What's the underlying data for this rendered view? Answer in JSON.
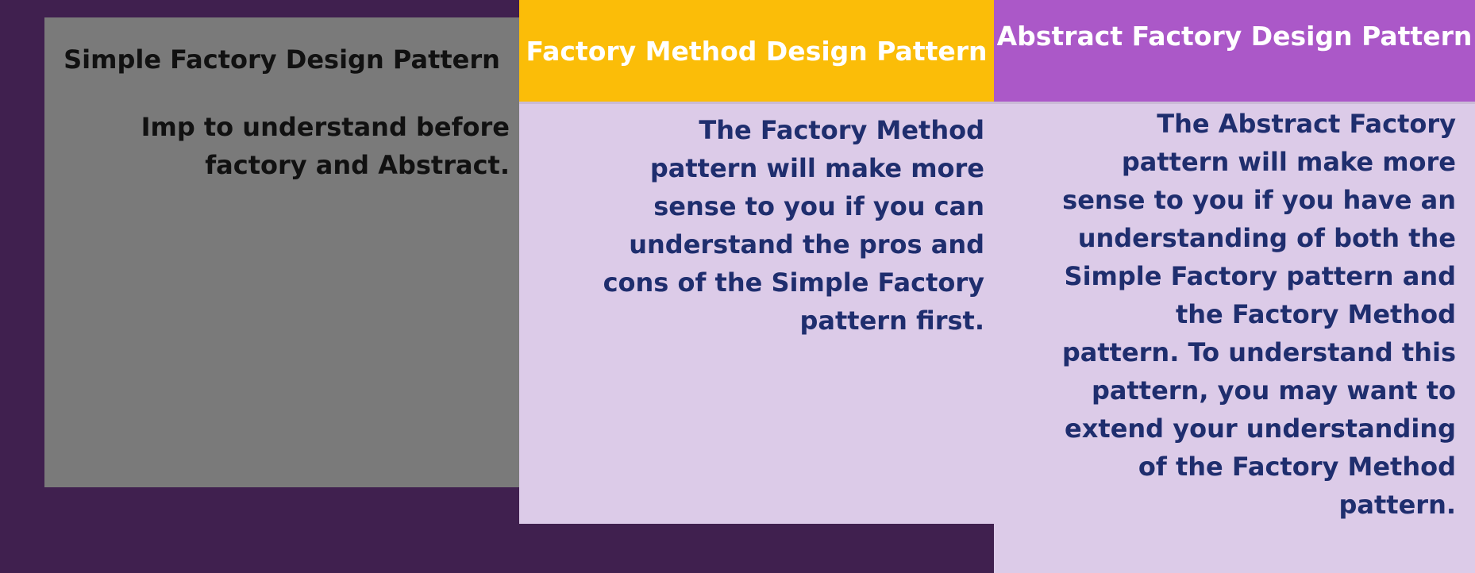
{
  "columns": {
    "simple": {
      "title": "Simple Factory Design Pattern",
      "lines": [
        "Imp to understand before",
        "factory and Abstract."
      ],
      "header_color": "#7a7a7a",
      "body_color": "#7a7a7a"
    },
    "factory_method": {
      "title": "Factory Method Design Pattern",
      "lines": [
        "The Factory Method",
        "pattern will make more",
        "sense to you if you can",
        "understand the pros and",
        "cons of the Simple Factory",
        "pattern first."
      ],
      "header_color": "#fbbd08",
      "body_color": "#dccbe8"
    },
    "abstract": {
      "title": "Abstract Factory Design Pattern",
      "lines": [
        "The Abstract Factory",
        "pattern will make more",
        "sense to you if you have an",
        "understanding of both the",
        "Simple Factory pattern and",
        "the Factory Method",
        "pattern. To understand this",
        "pattern, you may want to",
        "extend your understanding",
        "of the Factory Method",
        "pattern."
      ],
      "header_color": "#ab58c8",
      "body_color": "#dccbe8"
    }
  }
}
